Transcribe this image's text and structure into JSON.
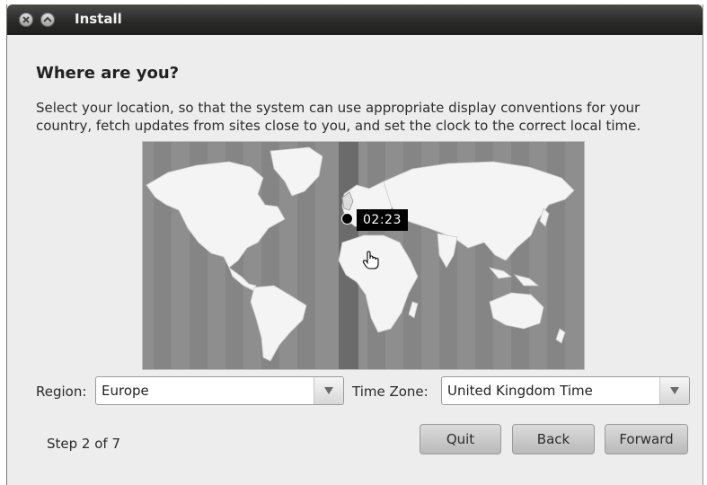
{
  "window": {
    "title": "Install"
  },
  "page": {
    "heading": "Where are you?",
    "description_line1": "Select your location, so that the system can use appropriate display conventions for your",
    "description_line2": "country, fetch updates from sites close to you, and set the clock to the correct local time."
  },
  "map": {
    "time_label": "02:23"
  },
  "region": {
    "label": "Region:",
    "value": "Europe"
  },
  "timezone": {
    "label": "Time Zone:",
    "value": "United Kingdom Time"
  },
  "footer": {
    "step": "Step 2 of 7",
    "quit_label": "Quit",
    "back_label": "Back",
    "forward_label": "Forward"
  },
  "icons": {
    "close": "close-icon",
    "minimize": "minimize-icon",
    "dropdown": "down-triangle-icon",
    "cursor": "hand-cursor-icon"
  }
}
